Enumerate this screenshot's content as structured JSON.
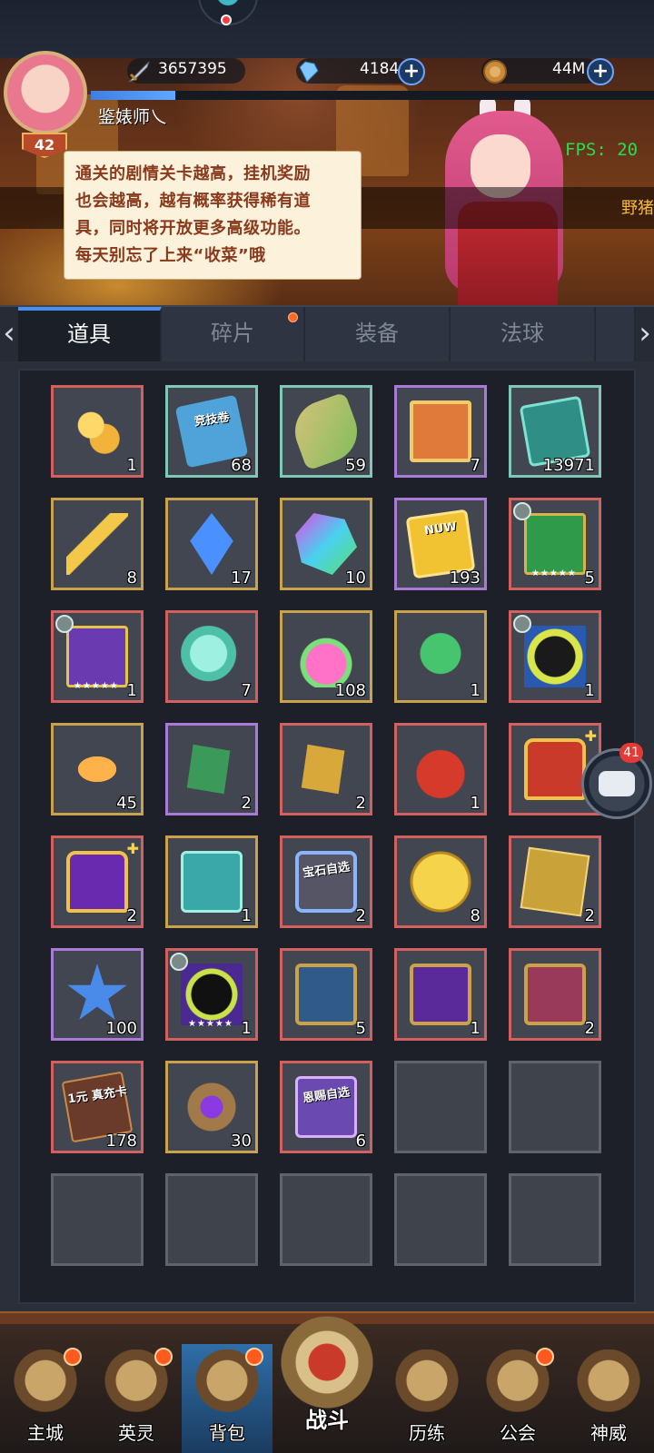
{
  "player": {
    "name": "鉴婊师乀",
    "level": "42",
    "xp_fraction": 0.15
  },
  "currencies": [
    {
      "name": "power",
      "icon": "sword-icon",
      "value": "3657395",
      "has_plus": false
    },
    {
      "name": "diamonds",
      "icon": "diamond-icon",
      "value": "4184",
      "has_plus": true
    },
    {
      "name": "gold",
      "icon": "gold-coin-icon",
      "value": "44M",
      "has_plus": true
    }
  ],
  "fps": "FPS: 20",
  "scroll_text": "野猪",
  "tip_lines": [
    "通关的剧情关卡越高，挂机奖励",
    "也会越高，越有概率获得稀有道",
    "具，同时将开放更多高级功能。",
    "每天别忘了上来“收菜”哦"
  ],
  "tabs": [
    {
      "label": "道具",
      "active": true,
      "has_dot": false
    },
    {
      "label": "碎片",
      "active": false,
      "has_dot": true
    },
    {
      "label": "装备",
      "active": false,
      "has_dot": false
    },
    {
      "label": "法球",
      "active": false,
      "has_dot": false
    }
  ],
  "items": [
    {
      "art": "coins",
      "quality": "red",
      "count": "1"
    },
    {
      "art": "ticket",
      "quality": "teal",
      "count": "68",
      "label": "竞技卷"
    },
    {
      "art": "scroll",
      "quality": "teal",
      "count": "59"
    },
    {
      "art": "banner-flag",
      "quality": "purple",
      "count": "7"
    },
    {
      "art": "teal-book",
      "quality": "teal",
      "count": "13971"
    },
    {
      "art": "key",
      "quality": "gold",
      "count": "8"
    },
    {
      "art": "crystal",
      "quality": "gold",
      "count": "17"
    },
    {
      "art": "gem",
      "quality": "gold",
      "count": "10"
    },
    {
      "art": "gold-card",
      "quality": "purple",
      "count": "193",
      "label": "NUW"
    },
    {
      "art": "green-card",
      "quality": "red",
      "count": "5",
      "crown": true,
      "stars": "★★★★★"
    },
    {
      "art": "purple-card",
      "quality": "red",
      "count": "1",
      "crown": true,
      "stars": "★★★★★"
    },
    {
      "art": "slime",
      "quality": "red",
      "count": "7"
    },
    {
      "art": "potion",
      "quality": "gold",
      "count": "108"
    },
    {
      "art": "sprout",
      "quality": "gold",
      "count": "1"
    },
    {
      "art": "shadow",
      "quality": "red",
      "count": "1",
      "crown": true
    },
    {
      "art": "egg",
      "quality": "gold",
      "count": "45"
    },
    {
      "art": "shard-green",
      "quality": "purple",
      "count": "2"
    },
    {
      "art": "shard-gold",
      "quality": "red",
      "count": "2"
    },
    {
      "art": "bag-red",
      "quality": "red",
      "count": "1"
    },
    {
      "art": "chest-red",
      "quality": "red",
      "count": "",
      "plus": true
    },
    {
      "art": "chest-purple",
      "quality": "red",
      "count": "2",
      "plus": true
    },
    {
      "art": "teal-page",
      "quality": "gold",
      "count": "1"
    },
    {
      "art": "gem-chest",
      "quality": "red",
      "count": "2",
      "label": "宝石自选"
    },
    {
      "art": "dollar",
      "quality": "red",
      "count": "8"
    },
    {
      "art": "gold-plate",
      "quality": "red",
      "count": "2"
    },
    {
      "art": "blue-star",
      "quality": "purple",
      "count": "100"
    },
    {
      "art": "shadow-purple",
      "quality": "red",
      "count": "1",
      "crown": true,
      "stars": "★★★★★"
    },
    {
      "art": "box-blue",
      "quality": "red",
      "count": "5"
    },
    {
      "art": "box-purple",
      "quality": "red",
      "count": "1"
    },
    {
      "art": "box-pink",
      "quality": "red",
      "count": "2"
    },
    {
      "art": "recharge-card",
      "quality": "red",
      "count": "178",
      "label": "1元 真充卡"
    },
    {
      "art": "emblem",
      "quality": "gold",
      "count": "30"
    },
    {
      "art": "gift",
      "quality": "red",
      "count": "6",
      "label": "恩赐自选"
    },
    {
      "art": "",
      "quality": "empty",
      "count": ""
    },
    {
      "art": "",
      "quality": "empty",
      "count": ""
    },
    {
      "art": "",
      "quality": "empty",
      "count": ""
    },
    {
      "art": "",
      "quality": "empty",
      "count": ""
    },
    {
      "art": "",
      "quality": "empty",
      "count": ""
    },
    {
      "art": "",
      "quality": "empty",
      "count": ""
    },
    {
      "art": "",
      "quality": "empty",
      "count": ""
    }
  ],
  "chat": {
    "badge": "41"
  },
  "nav": [
    {
      "label": "主城",
      "icon": "castle-icon",
      "has_dot": true,
      "active": false
    },
    {
      "label": "英灵",
      "icon": "helmet-icon",
      "has_dot": true,
      "active": false
    },
    {
      "label": "背包",
      "icon": "backpack-icon",
      "has_dot": true,
      "active": true
    },
    {
      "label": "历练",
      "icon": "portal-icon",
      "has_dot": false,
      "active": false
    },
    {
      "label": "公会",
      "icon": "guild-icon",
      "has_dot": true,
      "active": false
    },
    {
      "label": "神威",
      "icon": "divine-icon",
      "has_dot": false,
      "active": false
    }
  ],
  "battle": {
    "label": "战斗"
  }
}
